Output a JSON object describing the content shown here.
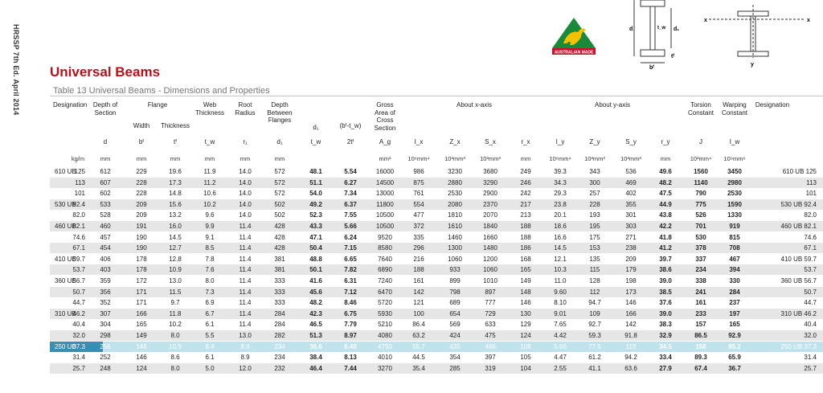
{
  "side_text": "HRSSP 7th Ed. April 2014",
  "title": "Universal Beams",
  "subtitle": "Table 13 Universal Beams - Dimensions and Properties",
  "logo_text": "AUSTRALIAN MADE",
  "diagram_labels": {
    "d": "d",
    "tw": "t_w",
    "d1": "d₁",
    "bf": "bᶠ",
    "tf": "tᶠ",
    "x1": "x",
    "x2": "x",
    "y": "y"
  },
  "headers": {
    "designation": "Designation",
    "depth_of_section": "Depth of\nSection",
    "flange": "Flange",
    "width": "Width",
    "thickness": "Thickness",
    "web_thickness": "Web\nThickness",
    "root_radius": "Root\nRadius",
    "depth_between": "Depth\nBetween\nFlanges",
    "gross_area": "Gross\nArea of\nCross\nSection",
    "about_x": "About x-axis",
    "about_y": "About y-axis",
    "torsion": "Torsion\nConstant",
    "warping": "Warping\nConstant",
    "designation_r": "Designation",
    "d1_head": "d₁",
    "bftw_head": "(bᶠ-t_w)"
  },
  "symbols": [
    "d",
    "bᶠ",
    "tᶠ",
    "t_w",
    "r₁",
    "d₁",
    "t_w",
    "2tᶠ",
    "A_g",
    "I_x",
    "Z_x",
    "S_x",
    "r_x",
    "I_y",
    "Z_y",
    "S_y",
    "r_y",
    "J",
    "I_w"
  ],
  "units": [
    "kg/m",
    "mm",
    "mm",
    "mm",
    "mm",
    "mm",
    "mm",
    "",
    "",
    "mm²",
    "10⁶mm⁴",
    "10³mm³",
    "10³mm³",
    "mm",
    "10⁶mm⁴",
    "10³mm³",
    "10³mm³",
    "mm",
    "10³mm⁴",
    "10⁹mm⁶"
  ],
  "rows": [
    {
      "g": "610 UB",
      "m": "125",
      "v": [
        "612",
        "229",
        "19.6",
        "11.9",
        "14.0",
        "572",
        "48.1",
        "5.54",
        "16000",
        "986",
        "3230",
        "3680",
        "249",
        "39.3",
        "343",
        "536",
        "49.6",
        "1560",
        "3450"
      ],
      "d": "610 UB 125",
      "style": "plain"
    },
    {
      "g": "",
      "m": "113",
      "v": [
        "607",
        "228",
        "17.3",
        "11.2",
        "14.0",
        "572",
        "51.1",
        "6.27",
        "14500",
        "875",
        "2880",
        "3290",
        "246",
        "34.3",
        "300",
        "469",
        "48.2",
        "1140",
        "2980"
      ],
      "d": "113",
      "style": "shaded"
    },
    {
      "g": "",
      "m": "101",
      "v": [
        "602",
        "228",
        "14.8",
        "10.6",
        "14.0",
        "572",
        "54.0",
        "7.34",
        "13000",
        "761",
        "2530",
        "2900",
        "242",
        "29.3",
        "257",
        "402",
        "47.5",
        "790",
        "2530"
      ],
      "d": "101",
      "style": "plain"
    },
    {
      "g": "530 UB",
      "m": "92.4",
      "v": [
        "533",
        "209",
        "15.6",
        "10.2",
        "14.0",
        "502",
        "49.2",
        "6.37",
        "11800",
        "554",
        "2080",
        "2370",
        "217",
        "23.8",
        "228",
        "355",
        "44.9",
        "775",
        "1590"
      ],
      "d": "530 UB 92.4",
      "style": "shaded"
    },
    {
      "g": "",
      "m": "82.0",
      "v": [
        "528",
        "209",
        "13.2",
        "9.6",
        "14.0",
        "502",
        "52.3",
        "7.55",
        "10500",
        "477",
        "1810",
        "2070",
        "213",
        "20.1",
        "193",
        "301",
        "43.8",
        "526",
        "1330"
      ],
      "d": "82.0",
      "style": "plain"
    },
    {
      "g": "460 UB",
      "m": "82.1",
      "v": [
        "460",
        "191",
        "16.0",
        "9.9",
        "11.4",
        "428",
        "43.3",
        "5.66",
        "10500",
        "372",
        "1610",
        "1840",
        "188",
        "18.6",
        "195",
        "303",
        "42.2",
        "701",
        "919"
      ],
      "d": "460 UB 82.1",
      "style": "shaded"
    },
    {
      "g": "",
      "m": "74.6",
      "v": [
        "457",
        "190",
        "14.5",
        "9.1",
        "11.4",
        "428",
        "47.1",
        "6.24",
        "9520",
        "335",
        "1460",
        "1660",
        "188",
        "16.6",
        "175",
        "271",
        "41.8",
        "530",
        "815"
      ],
      "d": "74.6",
      "style": "plain"
    },
    {
      "g": "",
      "m": "67.1",
      "v": [
        "454",
        "190",
        "12.7",
        "8.5",
        "11.4",
        "428",
        "50.4",
        "7.15",
        "8580",
        "296",
        "1300",
        "1480",
        "186",
        "14.5",
        "153",
        "238",
        "41.2",
        "378",
        "708"
      ],
      "d": "67.1",
      "style": "shaded"
    },
    {
      "g": "410 UB",
      "m": "59.7",
      "v": [
        "406",
        "178",
        "12.8",
        "7.8",
        "11.4",
        "381",
        "48.8",
        "6.65",
        "7640",
        "216",
        "1060",
        "1200",
        "168",
        "12.1",
        "135",
        "209",
        "39.7",
        "337",
        "467"
      ],
      "d": "410 UB 59.7",
      "style": "plain"
    },
    {
      "g": "",
      "m": "53.7",
      "v": [
        "403",
        "178",
        "10.9",
        "7.6",
        "11.4",
        "381",
        "50.1",
        "7.82",
        "6890",
        "188",
        "933",
        "1060",
        "165",
        "10.3",
        "115",
        "179",
        "38.6",
        "234",
        "394"
      ],
      "d": "53.7",
      "style": "shaded"
    },
    {
      "g": "360 UB",
      "m": "56.7",
      "v": [
        "359",
        "172",
        "13.0",
        "8.0",
        "11.4",
        "333",
        "41.6",
        "6.31",
        "7240",
        "161",
        "899",
        "1010",
        "149",
        "11.0",
        "128",
        "198",
        "39.0",
        "338",
        "330"
      ],
      "d": "360 UB 56.7",
      "style": "plain"
    },
    {
      "g": "",
      "m": "50.7",
      "v": [
        "356",
        "171",
        "11.5",
        "7.3",
        "11.4",
        "333",
        "45.6",
        "7.12",
        "6470",
        "142",
        "798",
        "897",
        "148",
        "9.60",
        "112",
        "173",
        "38.5",
        "241",
        "284"
      ],
      "d": "50.7",
      "style": "shaded"
    },
    {
      "g": "",
      "m": "44.7",
      "v": [
        "352",
        "171",
        "9.7",
        "6.9",
        "11.4",
        "333",
        "48.2",
        "8.46",
        "5720",
        "121",
        "689",
        "777",
        "146",
        "8.10",
        "94.7",
        "146",
        "37.6",
        "161",
        "237"
      ],
      "d": "44.7",
      "style": "plain"
    },
    {
      "g": "310 UB",
      "m": "46.2",
      "v": [
        "307",
        "166",
        "11.8",
        "6.7",
        "11.4",
        "284",
        "42.3",
        "6.75",
        "5930",
        "100",
        "654",
        "729",
        "130",
        "9.01",
        "109",
        "166",
        "39.0",
        "233",
        "197"
      ],
      "d": "310 UB 46.2",
      "style": "shaded"
    },
    {
      "g": "",
      "m": "40.4",
      "v": [
        "304",
        "165",
        "10.2",
        "6.1",
        "11.4",
        "284",
        "46.5",
        "7.79",
        "5210",
        "86.4",
        "569",
        "633",
        "129",
        "7.65",
        "92.7",
        "142",
        "38.3",
        "157",
        "165"
      ],
      "d": "40.4",
      "style": "plain"
    },
    {
      "g": "",
      "m": "32.0",
      "v": [
        "298",
        "149",
        "8.0",
        "5.5",
        "13.0",
        "282",
        "51.3",
        "8.97",
        "4080",
        "63.2",
        "424",
        "475",
        "124",
        "4.42",
        "59.3",
        "91.8",
        "32.9",
        "86.5",
        "92.9"
      ],
      "d": "32.0",
      "style": "shaded"
    },
    {
      "g": "250 UB",
      "m": "37.3",
      "v": [
        "256",
        "146",
        "10.9",
        "6.4",
        "8.9",
        "234",
        "36.6",
        "6.40",
        "4750",
        "55.7",
        "435",
        "486",
        "108",
        "5.66",
        "77.5",
        "119",
        "34.5",
        "158",
        "85.2"
      ],
      "d": "250 UB 37.3",
      "style": "hl"
    },
    {
      "g": "",
      "m": "31.4",
      "v": [
        "252",
        "146",
        "8.6",
        "6.1",
        "8.9",
        "234",
        "38.4",
        "8.13",
        "4010",
        "44.5",
        "354",
        "397",
        "105",
        "4.47",
        "61.2",
        "94.2",
        "33.4",
        "89.3",
        "65.9"
      ],
      "d": "31.4",
      "style": "plain"
    },
    {
      "g": "",
      "m": "25.7",
      "v": [
        "248",
        "124",
        "8.0",
        "5.0",
        "12.0",
        "232",
        "46.4",
        "7.44",
        "3270",
        "35.4",
        "285",
        "319",
        "104",
        "2.55",
        "41.1",
        "63.6",
        "27.9",
        "67.4",
        "36.7"
      ],
      "d": "25.7",
      "style": "shaded"
    }
  ]
}
